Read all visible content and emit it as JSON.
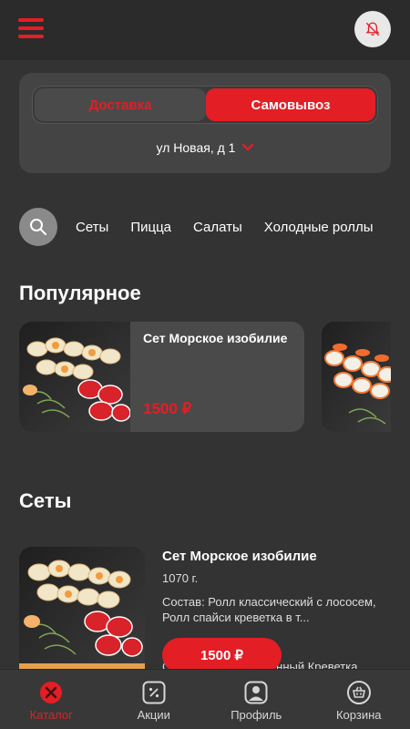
{
  "header": {
    "menu_icon": "hamburger-icon",
    "bell_icon": "bell-off-icon"
  },
  "delivery": {
    "tab_delivery": "Доставка",
    "tab_pickup": "Самовывоз",
    "active_tab": "pickup",
    "address": "ул Новая, д 1",
    "address_icon": "chevron-down-icon"
  },
  "categories": {
    "search_icon": "search-icon",
    "items": [
      "Сеты",
      "Пицца",
      "Салаты",
      "Холодные роллы"
    ]
  },
  "popular": {
    "title": "Популярное",
    "items": [
      {
        "name": "Сет Морское изобилие",
        "price": "1500 ₽"
      }
    ]
  },
  "sets": {
    "title": "Сеты",
    "items": [
      {
        "name": "Сет Морское изобилие",
        "weight": "1070 г.",
        "description": "Состав: Ролл классический с лососем, Ролл спайси креветка в т...",
        "description_next": "Состав: Ролл запеченный Креветка",
        "price": "1500 ₽"
      }
    ]
  },
  "tabbar": {
    "items": [
      {
        "label": "Каталог",
        "icon": "catalog-icon",
        "active": true
      },
      {
        "label": "Акции",
        "icon": "discount-icon",
        "active": false
      },
      {
        "label": "Профиль",
        "icon": "profile-icon",
        "active": false
      },
      {
        "label": "Корзина",
        "icon": "basket-icon",
        "active": false
      }
    ]
  },
  "colors": {
    "accent": "#e31e24",
    "background": "#333333",
    "card": "#4a4a4a"
  }
}
